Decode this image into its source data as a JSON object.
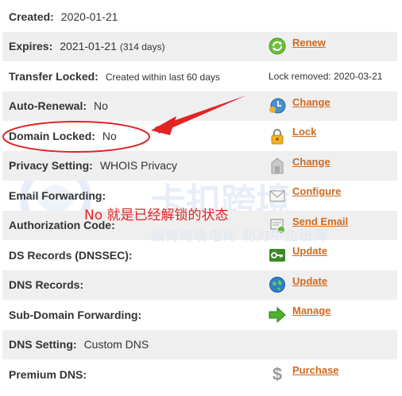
{
  "rows": [
    {
      "label": "Created:",
      "value": "2020-01-21"
    },
    {
      "label": "Expires:",
      "value": "2021-01-21",
      "note": "(314 days)",
      "action": "Renew"
    },
    {
      "label": "Transfer Locked:",
      "value": "Created within last 60 days",
      "right_text": "Lock removed: 2020-03-21"
    },
    {
      "label": "Auto-Renewal:",
      "value": "No",
      "action": "Change"
    },
    {
      "label": "Domain Locked:",
      "value": "No",
      "action": "Lock"
    },
    {
      "label": "Privacy Setting:",
      "value": "WHOIS Privacy",
      "action": "Change"
    },
    {
      "label": "Email Forwarding:",
      "action": "Configure"
    },
    {
      "label": "Authorization Code:",
      "action": "Send Email"
    },
    {
      "label": "DS Records (DNSSEC):",
      "action": "Update"
    },
    {
      "label": "DNS Records:",
      "action": "Update"
    },
    {
      "label": "Sub-Domain Forwarding:",
      "action": "Manage"
    },
    {
      "label": "DNS Setting:",
      "value": "Custom DNS"
    },
    {
      "label": "Premium DNS:",
      "action": "Purchase"
    }
  ],
  "annotation": {
    "text": "No 就是已经解锁的状态",
    "color": "#e02424"
  },
  "watermark": {
    "text": "服务跨境电商 助力中企出海",
    "big_text": "卡扣跨境"
  },
  "colors": {
    "link": "#d06a1e",
    "row_shade": "#efefef"
  },
  "icons": [
    "renew-icon",
    "clock-icon",
    "lock-icon",
    "privacy-icon",
    "envelope-icon",
    "send-email-icon",
    "key-icon",
    "globe-icon",
    "arrow-right-icon",
    "dollar-icon"
  ]
}
